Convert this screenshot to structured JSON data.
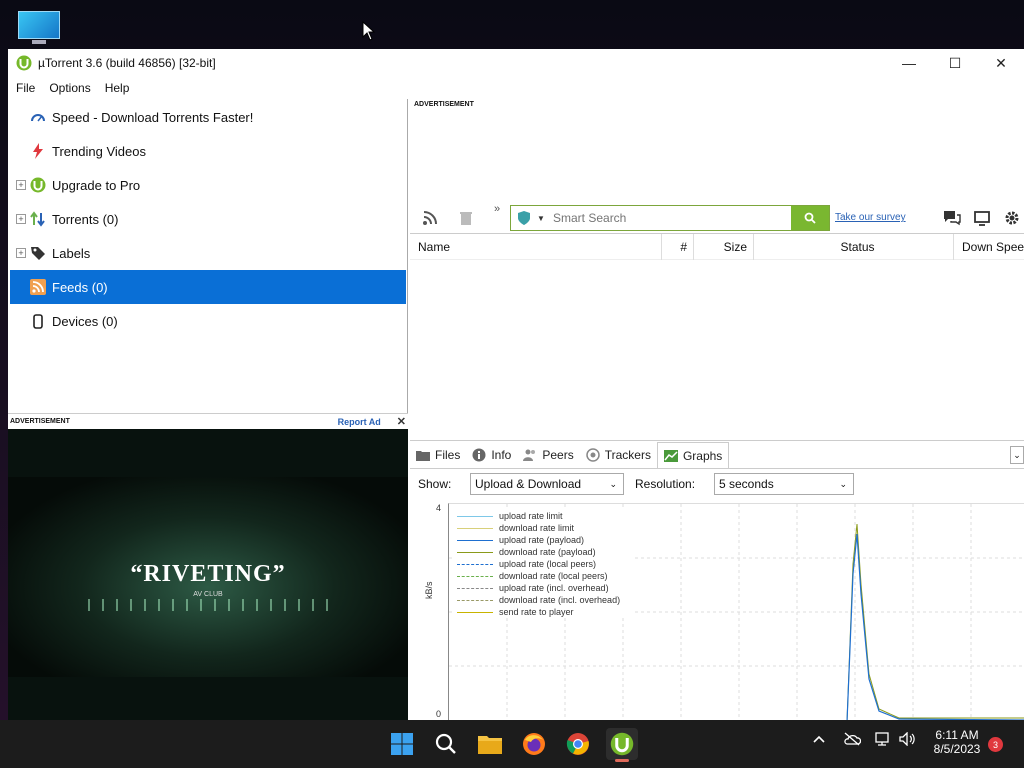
{
  "window": {
    "title": "µTorrent 3.6  (build 46856) [32-bit]"
  },
  "menu": [
    "File",
    "Options",
    "Help"
  ],
  "sidebar": {
    "items": [
      {
        "label": "Speed - Download Torrents Faster!"
      },
      {
        "label": "Trending Videos"
      },
      {
        "label": "Upgrade to Pro"
      },
      {
        "label": "Torrents (0)"
      },
      {
        "label": "Labels"
      },
      {
        "label": "Feeds (0)"
      },
      {
        "label": "Devices (0)"
      }
    ]
  },
  "ad_left": {
    "label": "ADVERTISEMENT",
    "report": "Report Ad",
    "quote": "“RIVETING”",
    "source": "AV CLUB"
  },
  "ad_top": {
    "label": "ADVERTISEMENT"
  },
  "toolbar": {
    "search_placeholder": "Smart Search",
    "survey": "Take our survey"
  },
  "list": {
    "columns": [
      "Name",
      "#",
      "Size",
      "Status",
      "Down Speed"
    ]
  },
  "tabs": [
    "Files",
    "Info",
    "Peers",
    "Trackers",
    "Graphs"
  ],
  "graph_controls": {
    "show_label": "Show:",
    "show_value": "Upload & Download",
    "resolution_label": "Resolution:",
    "resolution_value": "5 seconds"
  },
  "graph": {
    "ylabel": "kB/s",
    "ymax": "4",
    "ymin": "0",
    "legend": [
      {
        "label": "upload rate limit",
        "color": "#7ec8e8",
        "style": "solid"
      },
      {
        "label": "download rate limit",
        "color": "#d8d07a",
        "style": "solid"
      },
      {
        "label": "upload rate (payload)",
        "color": "#1e6fd0",
        "style": "solid"
      },
      {
        "label": "download rate (payload)",
        "color": "#8a9a1a",
        "style": "solid"
      },
      {
        "label": "upload rate (local peers)",
        "color": "#1e6fd0",
        "style": "dashed"
      },
      {
        "label": "download rate (local peers)",
        "color": "#6ab04c",
        "style": "dashed"
      },
      {
        "label": "upload rate (incl. overhead)",
        "color": "#888888",
        "style": "dashed"
      },
      {
        "label": "download rate (incl. overhead)",
        "color": "#999966",
        "style": "dashed"
      },
      {
        "label": "send rate to player",
        "color": "#c8b400",
        "style": "solid"
      }
    ]
  },
  "taskbar": {
    "time": "6:11 AM",
    "date": "8/5/2023",
    "notifications": "3"
  }
}
